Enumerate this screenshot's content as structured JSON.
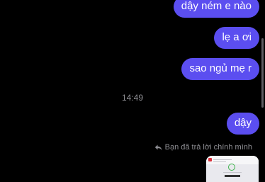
{
  "messages": [
    {
      "text": "dậy ném e nào"
    },
    {
      "text": "lẹ a ơi"
    },
    {
      "text": "sao ngủ mẹ r"
    },
    {
      "text": "dậy"
    }
  ],
  "timestamp": "14:49",
  "reply_note": "Bạn đã trả lời chính mình",
  "colors": {
    "background": "#000000",
    "bubble": "#5b4ef0",
    "meta_text": "#8e8e93"
  },
  "icons": {
    "reply": "reply-arrow-icon",
    "attachment_check": "check-icon"
  }
}
